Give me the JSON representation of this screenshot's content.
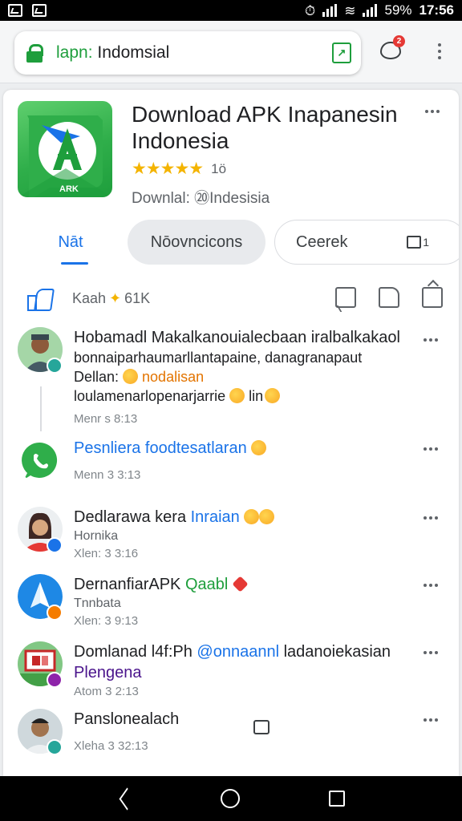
{
  "status_bar": {
    "battery": "59%",
    "time": "17:56"
  },
  "browser": {
    "url_prefix": "lapn:",
    "url_main": " Indomsial",
    "notification_count": "2"
  },
  "app": {
    "title": "Download APK Inapanesin Indonesia",
    "stars": "★★★★★",
    "rating_count": "1ö",
    "downloads": "Downlal:  ⑳Indesisia",
    "icon_label": "ARK",
    "brand_color": "#2fae4a"
  },
  "tabs": [
    {
      "label": "Nāt"
    },
    {
      "label": "Nōovncicons"
    },
    {
      "label": "Ceerek"
    }
  ],
  "reactions": {
    "label": "Kaah",
    "count": "61K",
    "emoji": "✦"
  },
  "feed": [
    {
      "title": "Hobamadl Makalkanouialecbaan iralbalkakaol",
      "line2": "bonnaiparhaumarllantapaine, danagranapaut",
      "line3_a": "Dellan: ",
      "line3_b": " nodalisan",
      "line4": "loulamenarlopenarjarrie ",
      "line4_b": " lin",
      "time": "Menr s  8:13"
    },
    {
      "title": "Pesnliera foodtesatlaran",
      "time": "Menn 3  3:13"
    },
    {
      "title": "Dedlarawa kera ",
      "title_b": "Inraian",
      "sub": "Hornika",
      "time": "Xlen: 3  3:16"
    },
    {
      "title": "DernanfiarAPK ",
      "title_b": "Qaabl",
      "sub": "Tnnbata",
      "time": "Xlen: 3  9:13"
    },
    {
      "title": "Domlanad l4f:Ph  ",
      "title_b": "@onnaannl",
      "title_c": " ladanoiekasian",
      "sub": "Plengena",
      "time": "Atom 3  2:13"
    },
    {
      "title": "Panslonealach",
      "time": "Xleha  3  32:13"
    }
  ]
}
